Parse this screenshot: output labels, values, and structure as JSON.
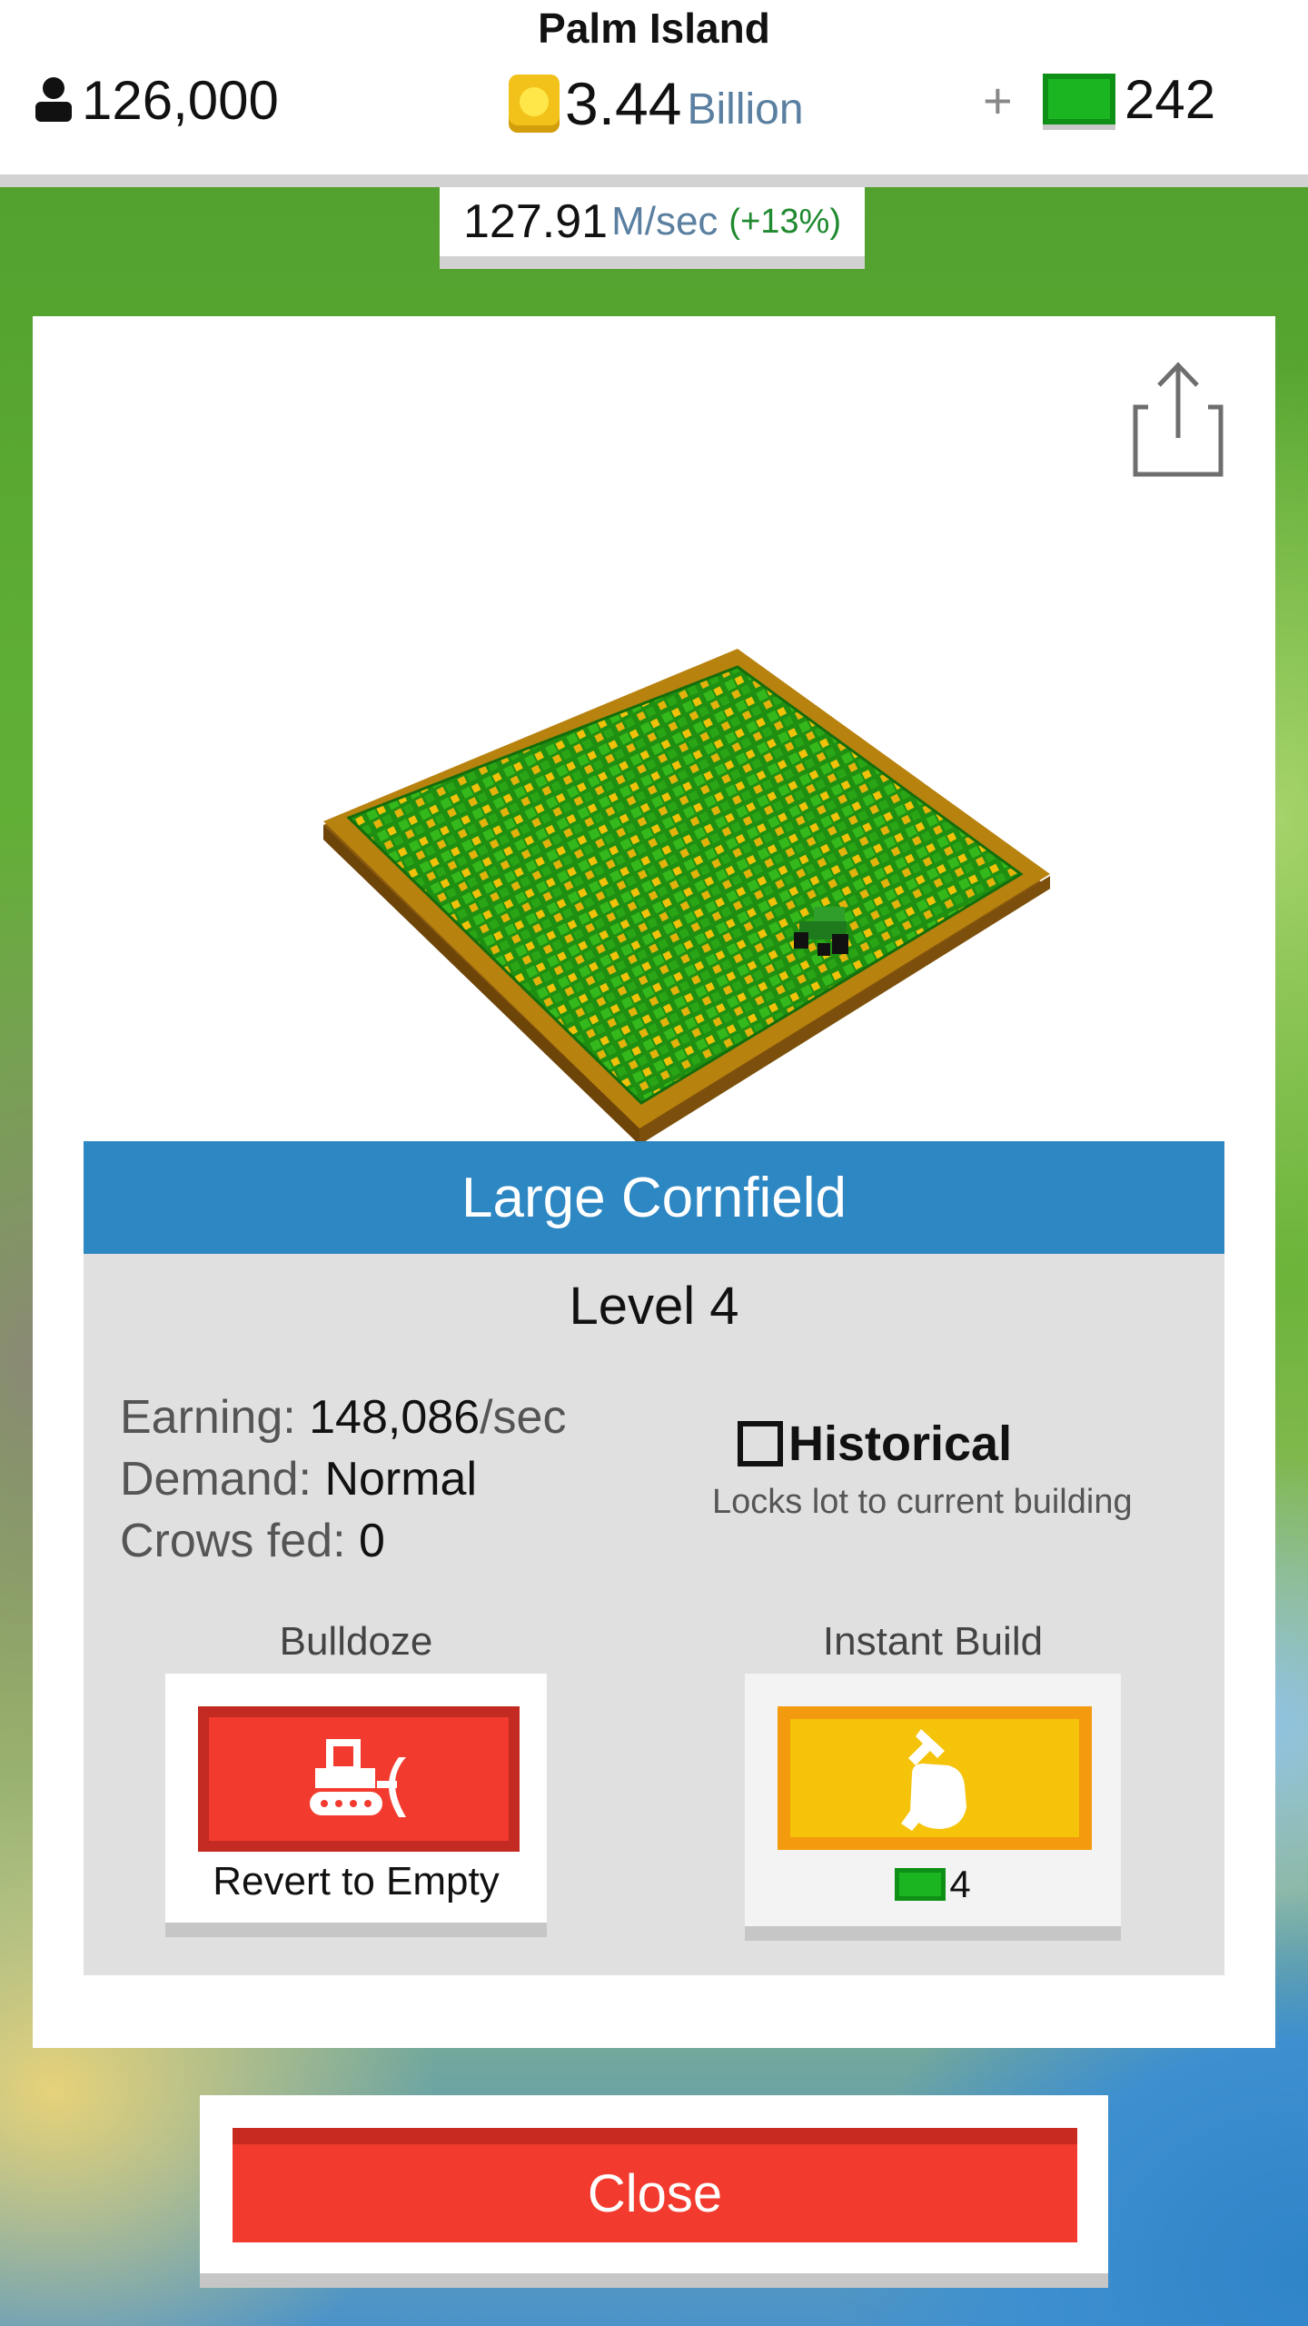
{
  "header": {
    "island_name": "Palm Island",
    "population": "126,000",
    "population_icon": "person-icon",
    "money_value": "3.44",
    "money_unit": "Billion",
    "coin_icon": "coin-icon",
    "plus_label": "+",
    "cash_count": "242",
    "cash_icon": "cash-icon"
  },
  "income": {
    "value": "127.91",
    "unit": "M/sec",
    "boost": "(+13%)"
  },
  "card": {
    "share_icon": "share-icon",
    "building_name": "Large Cornfield",
    "level": "Level 4",
    "stats": [
      {
        "label": "Earning: ",
        "value": "148,086",
        "suffix": "/sec"
      },
      {
        "label": "Demand: ",
        "value": "Normal",
        "suffix": ""
      },
      {
        "label": "Crows fed: ",
        "value": "0",
        "suffix": ""
      }
    ],
    "historical": {
      "label": "Historical",
      "description": "Locks lot to current building",
      "checked": false
    },
    "bulldoze": {
      "label": "Bulldoze",
      "button_text": "Revert to Empty",
      "icon": "bulldozer-icon"
    },
    "instant_build": {
      "label": "Instant Build",
      "cost": "4",
      "icon": "hammer-hand-icon"
    }
  },
  "close_label": "Close",
  "colors": {
    "header_blue": "#2d87c3",
    "bulldoze_red": "#f23b2e",
    "build_yellow": "#f5c30a",
    "cash_green": "#1bb522",
    "boost_green": "#1f8a2f"
  }
}
